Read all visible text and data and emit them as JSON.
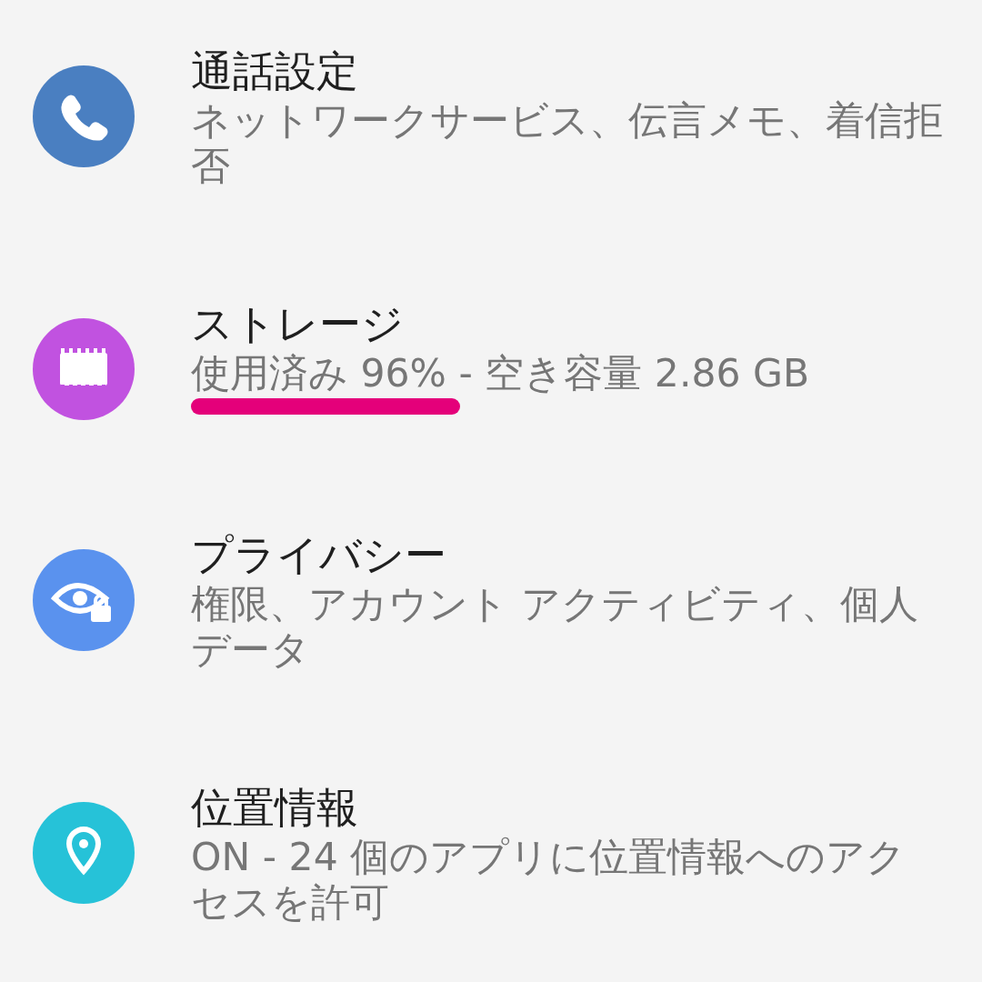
{
  "settings_items": [
    {
      "kind": "phone",
      "color": "#4a7fc1",
      "title": "通話設定",
      "subtitle": "ネットワークサービス、伝言メモ、着信拒否",
      "underline_mark": false
    },
    {
      "kind": "storage",
      "color": "#c152e0",
      "title": "ストレージ",
      "subtitle": "使用済み 96% - 空き容量 2.86 GB",
      "underline_mark": true
    },
    {
      "kind": "privacy",
      "color": "#5a92ee",
      "title": "プライバシー",
      "subtitle": "権限、アカウント アクティビティ、個人データ",
      "underline_mark": false
    },
    {
      "kind": "location",
      "color": "#26c2d8",
      "title": "位置情報",
      "subtitle": "ON - 24 個のアプリに位置情報へのアクセスを許可",
      "underline_mark": false
    }
  ]
}
